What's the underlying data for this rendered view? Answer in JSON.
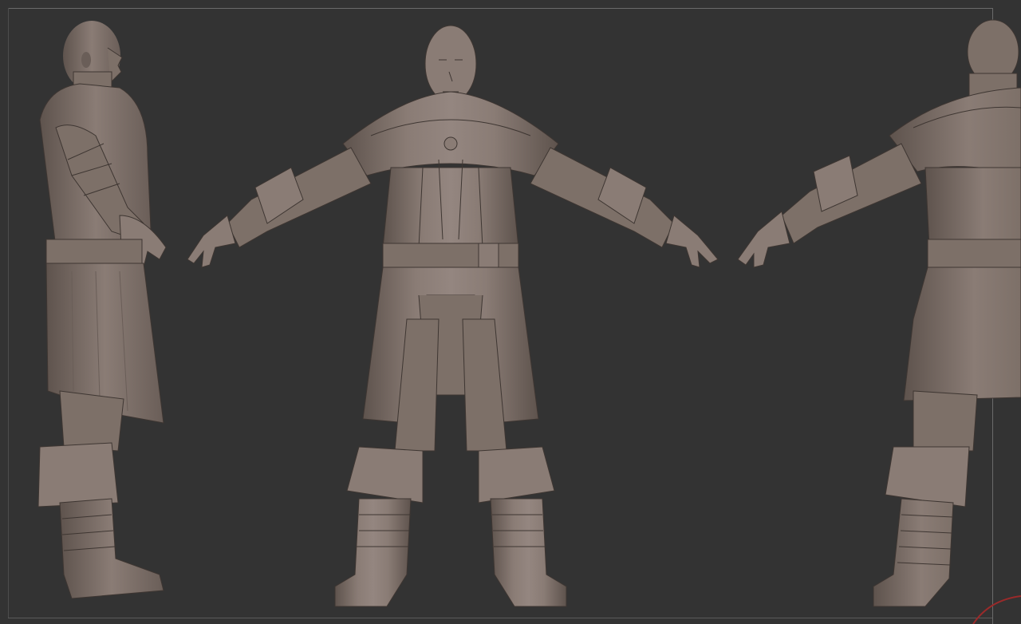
{
  "viewport": {
    "background": "#333333",
    "frame_color": "#6a6a6a",
    "model_color": "#7d7068",
    "model_shadow": "#5e534d",
    "model_highlight": "#948680",
    "line_color": "#3e3632",
    "corner_arc_color": "#9a2a2a"
  },
  "views": [
    {
      "name": "side-view",
      "label": ""
    },
    {
      "name": "front-view",
      "label": ""
    },
    {
      "name": "back-view",
      "label": ""
    }
  ]
}
